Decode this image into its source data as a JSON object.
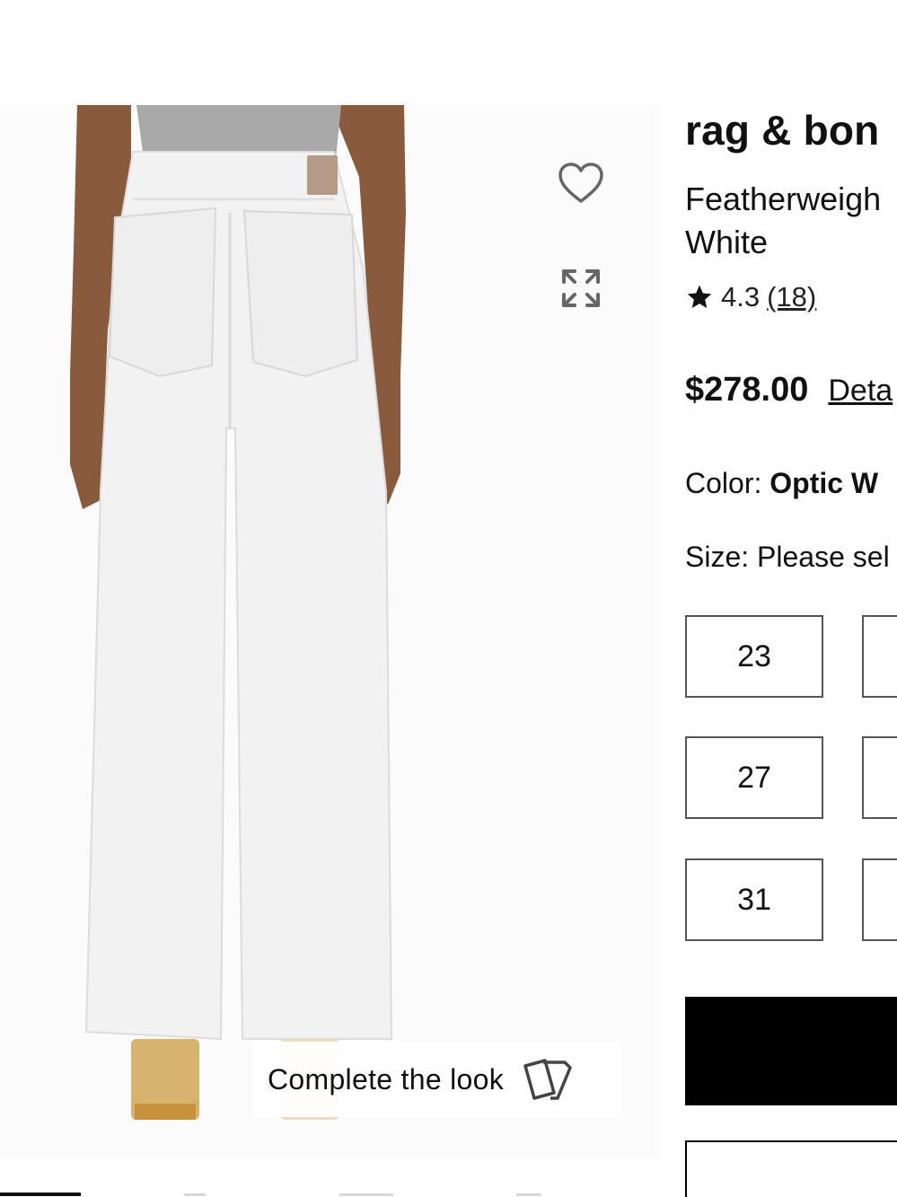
{
  "gallery": {
    "image_alt": "rag & bone Featherweight wide-leg jeans, back view",
    "heart_icon": "heart-outline-icon",
    "expand_icon": "expand-arrows-icon",
    "complete_look_label": "Complete the look",
    "complete_look_icon": "cards-icon"
  },
  "product": {
    "brand": "rag & bon",
    "name_line1": "Featherweigh",
    "name_line2": "White",
    "rating_value": "4.3",
    "review_count": "(18)",
    "price": "$278.00",
    "details_link": "Deta",
    "color_label": "Color: ",
    "color_value": "Optic W",
    "size_label": "Size: Please sel",
    "sizes": [
      "23",
      "27",
      "31"
    ]
  },
  "colors": {
    "text": "#111111",
    "button_black": "#000000",
    "border_gray": "#555555"
  }
}
